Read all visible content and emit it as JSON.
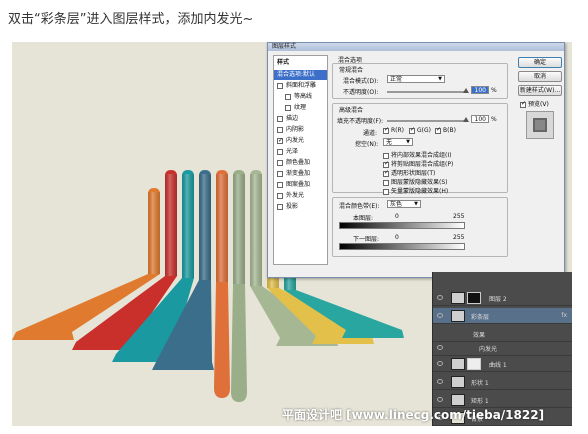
{
  "caption": "双击“彩条层”进入图层样式，添加内发光~",
  "colors": {
    "background": "#e6e4d7",
    "stripes": [
      "#e07a2e",
      "#c9302c",
      "#1a9aa0",
      "#3a6e8a",
      "#e0703a",
      "#9aae8a",
      "#a6b893",
      "#e3c04a",
      "#2aa6a0"
    ],
    "dialog_accent": "#3b6fc9"
  },
  "dialog": {
    "title": "图层样式",
    "sidebar": {
      "header": "样式",
      "items": [
        {
          "label": "混合选项:默认",
          "active": true
        },
        {
          "label": "斜面和浮雕",
          "checked": false
        },
        {
          "label": "等高线",
          "checked": false,
          "sub": true
        },
        {
          "label": "纹理",
          "checked": false,
          "sub": true
        },
        {
          "label": "描边",
          "checked": false
        },
        {
          "label": "内阴影",
          "checked": false
        },
        {
          "label": "内发光",
          "checked": true
        },
        {
          "label": "光泽",
          "checked": false
        },
        {
          "label": "颜色叠加",
          "checked": false
        },
        {
          "label": "渐变叠加",
          "checked": false
        },
        {
          "label": "图案叠加",
          "checked": false
        },
        {
          "label": "外发光",
          "checked": false
        },
        {
          "label": "投影",
          "checked": false
        }
      ]
    },
    "blend_options": {
      "section_title": "混合选项",
      "general_title": "常规混合",
      "mode_label": "混合模式(D):",
      "mode_value": "正常",
      "opacity_label": "不透明度(O):",
      "opacity_value": "100",
      "percent": "%",
      "advanced_title": "高级混合",
      "fill_label": "填充不透明度(F):",
      "fill_value": "100",
      "channels_label": "通道:",
      "channel_r": "R(R)",
      "channel_g": "G(G)",
      "channel_b": "B(B)",
      "knockout_label": "挖空(N):",
      "knockout_value": "无",
      "checks": [
        {
          "label": "将内部效果混合成组(I)",
          "checked": false
        },
        {
          "label": "将剪贴图层混合成组(P)",
          "checked": true
        },
        {
          "label": "透明形状图层(T)",
          "checked": true
        },
        {
          "label": "图层蒙版隐藏效果(S)",
          "checked": false
        },
        {
          "label": "矢量蒙版隐藏效果(H)",
          "checked": false
        }
      ],
      "blend_if_label": "混合颜色带(E):",
      "blend_if_value": "灰色",
      "this_layer_label": "本图层:",
      "this_layer_min": "0",
      "this_layer_max": "255",
      "underlying_label": "下一图层:",
      "underlying_min": "0",
      "underlying_max": "255"
    },
    "buttons": {
      "ok": "确定",
      "cancel": "取消",
      "new_style": "新建样式(W)...",
      "preview": "预览(V)"
    }
  },
  "layers": [
    {
      "name": "图层 2",
      "fx": ""
    },
    {
      "name": "彩条层",
      "fx": "fx",
      "selected": true
    },
    {
      "name": "效果",
      "fx": ""
    },
    {
      "name": "内发光",
      "fx": ""
    },
    {
      "name": "曲线 1",
      "fx": ""
    },
    {
      "name": "形状 1",
      "fx": ""
    },
    {
      "name": "矩形 1",
      "fx": ""
    },
    {
      "name": "背景",
      "fx": ""
    }
  ],
  "watermark": "平面设计吧 [www.linecg.com/tieba/1822]"
}
